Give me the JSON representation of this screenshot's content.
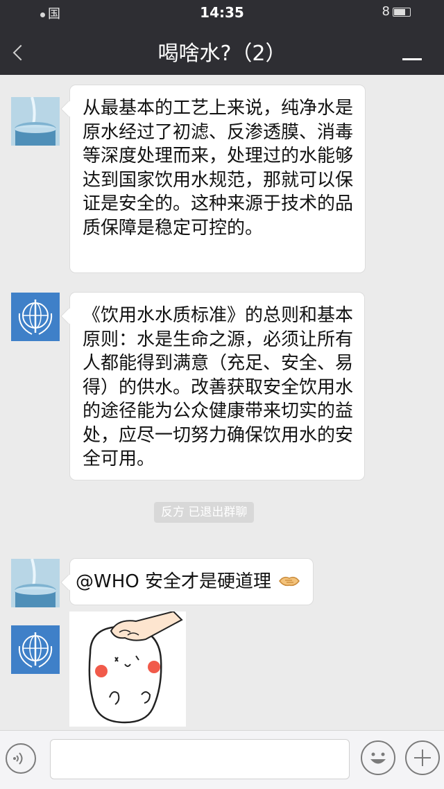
{
  "status_bar": {
    "carrier": "国",
    "time": "14:35",
    "battery": "8"
  },
  "header": {
    "title": "喝啥水?（2）"
  },
  "messages": [
    {
      "sender": "water",
      "text": "从最基本的工艺上来说，纯净水是原水经过了初滤、反渗透膜、消毒等深度处理而来，处理过的水能够达到国家饮用水规范，那就可以保证是安全的。这种来源于技术的品质保障是稳定可控的。"
    },
    {
      "sender": "who",
      "text": "《饮用水水质标准》的总则和基本原则：水是生命之源，必须让所有人都能得到满意（充足、安全、易得）的供水。改善获取安全饮用水的途径能为公众健康带来切实的益处，应尽一切努力确保饮用水的安全可用。"
    },
    {
      "sender": "water",
      "text": "@WHO 安全才是硬道理"
    }
  ],
  "system_tip": "反方 已退出群聊",
  "icons": {
    "back": "chevron-left-icon",
    "menu": "menu-icon",
    "voice": "voice-icon",
    "emoji": "emoji-icon",
    "plus": "plus-icon"
  },
  "colors": {
    "header_bg": "#2e2e33",
    "chat_bg": "#ebebeb",
    "bubble_bg": "#ffffff",
    "who_blue": "#3f80c8"
  }
}
